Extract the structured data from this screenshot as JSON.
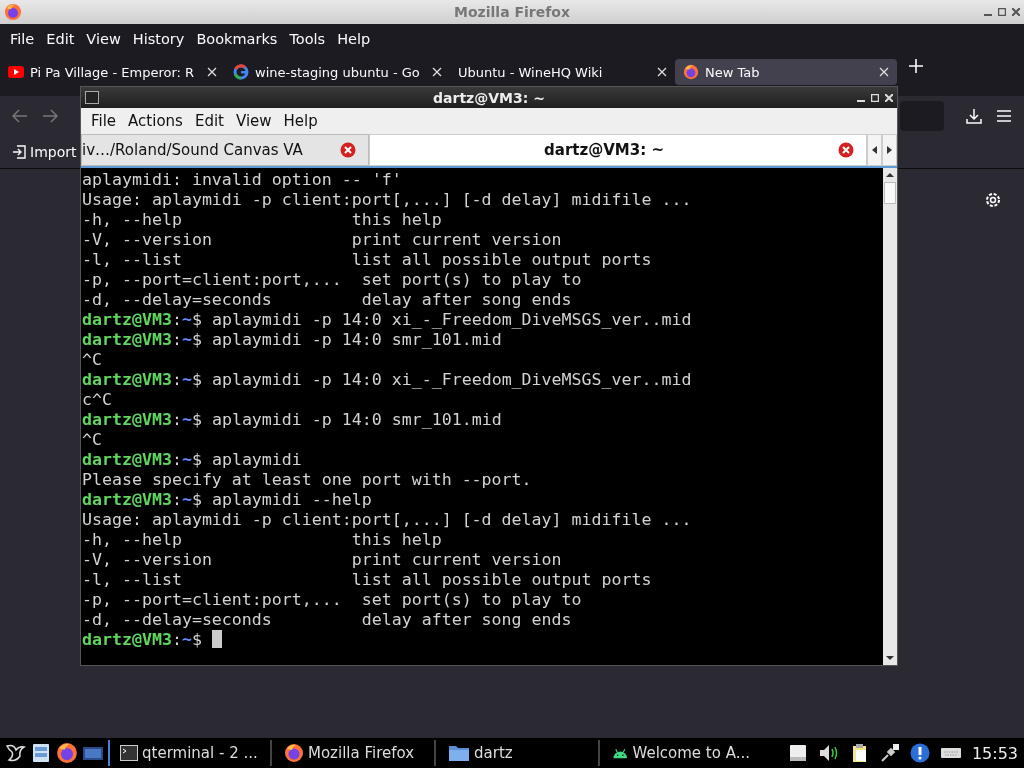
{
  "firefox": {
    "title": "Mozilla Firefox",
    "menu": [
      "File",
      "Edit",
      "View",
      "History",
      "Bookmarks",
      "Tools",
      "Help"
    ],
    "tabs": [
      {
        "label": "Pi Pa Village - Emperor: R",
        "selected": false
      },
      {
        "label": "wine-staging ubuntu - Go",
        "selected": false
      },
      {
        "label": "Ubuntu - WineHQ Wiki",
        "selected": false
      },
      {
        "label": "New Tab",
        "selected": true
      }
    ],
    "bookmarks": [
      "Import"
    ]
  },
  "terminal": {
    "title": "dartz@VM3: ~",
    "menu": [
      "File",
      "Actions",
      "Edit",
      "View",
      "Help"
    ],
    "tabs": [
      {
        "label": "iv…/Roland/Sound Canvas VA",
        "selected": false
      },
      {
        "label": "dartz@VM3: ~",
        "selected": true
      }
    ],
    "lines": [
      {
        "kind": "output",
        "text": "aplaymidi: invalid option -- 'f'"
      },
      {
        "kind": "output",
        "text": "Usage: aplaymidi -p client:port[,...] [-d delay] midifile ..."
      },
      {
        "kind": "output",
        "text": "-h, --help                 this help"
      },
      {
        "kind": "output",
        "text": "-V, --version              print current version"
      },
      {
        "kind": "output",
        "text": "-l, --list                 list all possible output ports"
      },
      {
        "kind": "output",
        "text": "-p, --port=client:port,...  set port(s) to play to"
      },
      {
        "kind": "output",
        "text": "-d, --delay=seconds         delay after song ends"
      },
      {
        "kind": "prompt",
        "user": "dartz@VM3",
        "sep": ":",
        "path": "~",
        "symbol": "$",
        "command": " aplaymidi -p 14:0 xi_-_Freedom_DiveMSGS_ver..mid",
        "cursor": false
      },
      {
        "kind": "prompt",
        "user": "dartz@VM3",
        "sep": ":",
        "path": "~",
        "symbol": "$",
        "command": " aplaymidi -p 14:0 smr_101.mid",
        "cursor": false
      },
      {
        "kind": "output",
        "text": "^C"
      },
      {
        "kind": "prompt",
        "user": "dartz@VM3",
        "sep": ":",
        "path": "~",
        "symbol": "$",
        "command": " aplaymidi -p 14:0 xi_-_Freedom_DiveMSGS_ver..mid",
        "cursor": false
      },
      {
        "kind": "output",
        "text": "c^C"
      },
      {
        "kind": "prompt",
        "user": "dartz@VM3",
        "sep": ":",
        "path": "~",
        "symbol": "$",
        "command": " aplaymidi -p 14:0 smr_101.mid",
        "cursor": false
      },
      {
        "kind": "output",
        "text": "^C"
      },
      {
        "kind": "prompt",
        "user": "dartz@VM3",
        "sep": ":",
        "path": "~",
        "symbol": "$",
        "command": " aplaymidi",
        "cursor": false
      },
      {
        "kind": "output",
        "text": "Please specify at least one port with --port."
      },
      {
        "kind": "prompt",
        "user": "dartz@VM3",
        "sep": ":",
        "path": "~",
        "symbol": "$",
        "command": " aplaymidi --help",
        "cursor": false
      },
      {
        "kind": "output",
        "text": "Usage: aplaymidi -p client:port[,...] [-d delay] midifile ..."
      },
      {
        "kind": "output",
        "text": "-h, --help                 this help"
      },
      {
        "kind": "output",
        "text": "-V, --version              print current version"
      },
      {
        "kind": "output",
        "text": "-l, --list                 list all possible output ports"
      },
      {
        "kind": "output",
        "text": "-p, --port=client:port,...  set port(s) to play to"
      },
      {
        "kind": "output",
        "text": "-d, --delay=seconds         delay after song ends"
      },
      {
        "kind": "prompt",
        "user": "dartz@VM3",
        "sep": ":",
        "path": "~",
        "symbol": "$",
        "cursor": true
      }
    ]
  },
  "taskbar": {
    "tasks": [
      {
        "label": "qterminal - 2 ..."
      },
      {
        "label": "Mozilla Firefox"
      },
      {
        "label": "dartz"
      },
      {
        "label": "Welcome to A..."
      }
    ],
    "clock": "15:53"
  }
}
